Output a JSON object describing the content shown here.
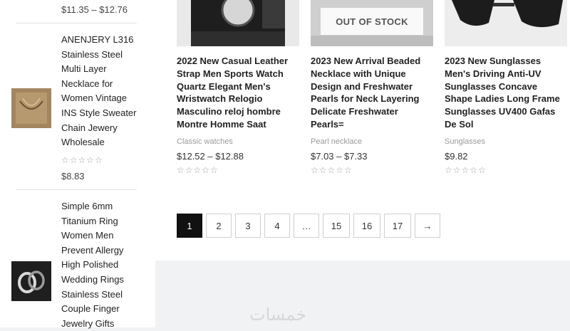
{
  "sidebar": {
    "top_price": "$11.35 – $12.76",
    "items": [
      {
        "title_lines": [
          "ANENJERY L316",
          "Stainless Steel",
          "Multi Layer",
          "Necklace for",
          "Women Vintage",
          "INS Style Sweater",
          "Chain Jewery",
          "Wholesale"
        ],
        "stars": "☆☆☆☆☆",
        "price": "$8.83",
        "thumb_icon": "necklace-thumbnail"
      },
      {
        "title_lines": [
          "Simple 6mm",
          "Titanium Ring",
          "Women Men",
          "Prevent Allergy",
          "High Polished",
          "Wedding Rings",
          "Stainless Steel",
          "Couple Finger",
          "Jewelry Gifts"
        ],
        "thumb_icon": "rings-thumbnail"
      }
    ]
  },
  "products": [
    {
      "title": "2022 New Casual Leather Strap Men Sports Watch Quartz Elegant Men's Wristwatch Relogio Masculino reloj hombre Montre Homme Saat",
      "category": "Classic watches",
      "price": "$12.52 – $12.88",
      "stars": "☆☆☆☆☆",
      "image_icon": "watch-image"
    },
    {
      "title": "2023 New Arrival Beaded Necklace with Unique Design and Freshwater Pearls for Neck Layering Delicate Freshwater Pearls=",
      "category": "Pearl necklace",
      "price": "$7.03 – $7.33",
      "stars": "☆☆☆☆☆",
      "badge": "OUT OF STOCK",
      "image_icon": "necklace-image"
    },
    {
      "title": "2023 New Sunglasses Men's Driving Anti-UV Sunglasses Concave Shape Ladies Long Frame Sunglasses UV400 Gafas De Sol",
      "category": "Sunglasses",
      "price": "$9.82",
      "stars": "☆☆☆☆☆",
      "image_icon": "sunglasses-image"
    }
  ],
  "pagination": {
    "pages": [
      "1",
      "2",
      "3",
      "4",
      "…",
      "15",
      "16",
      "17",
      "→"
    ],
    "current": "1"
  },
  "watermark": "خمسات",
  "colors": {
    "active_page_bg": "#111111",
    "background": "#f1f2f4",
    "star": "#9aa0a6"
  }
}
